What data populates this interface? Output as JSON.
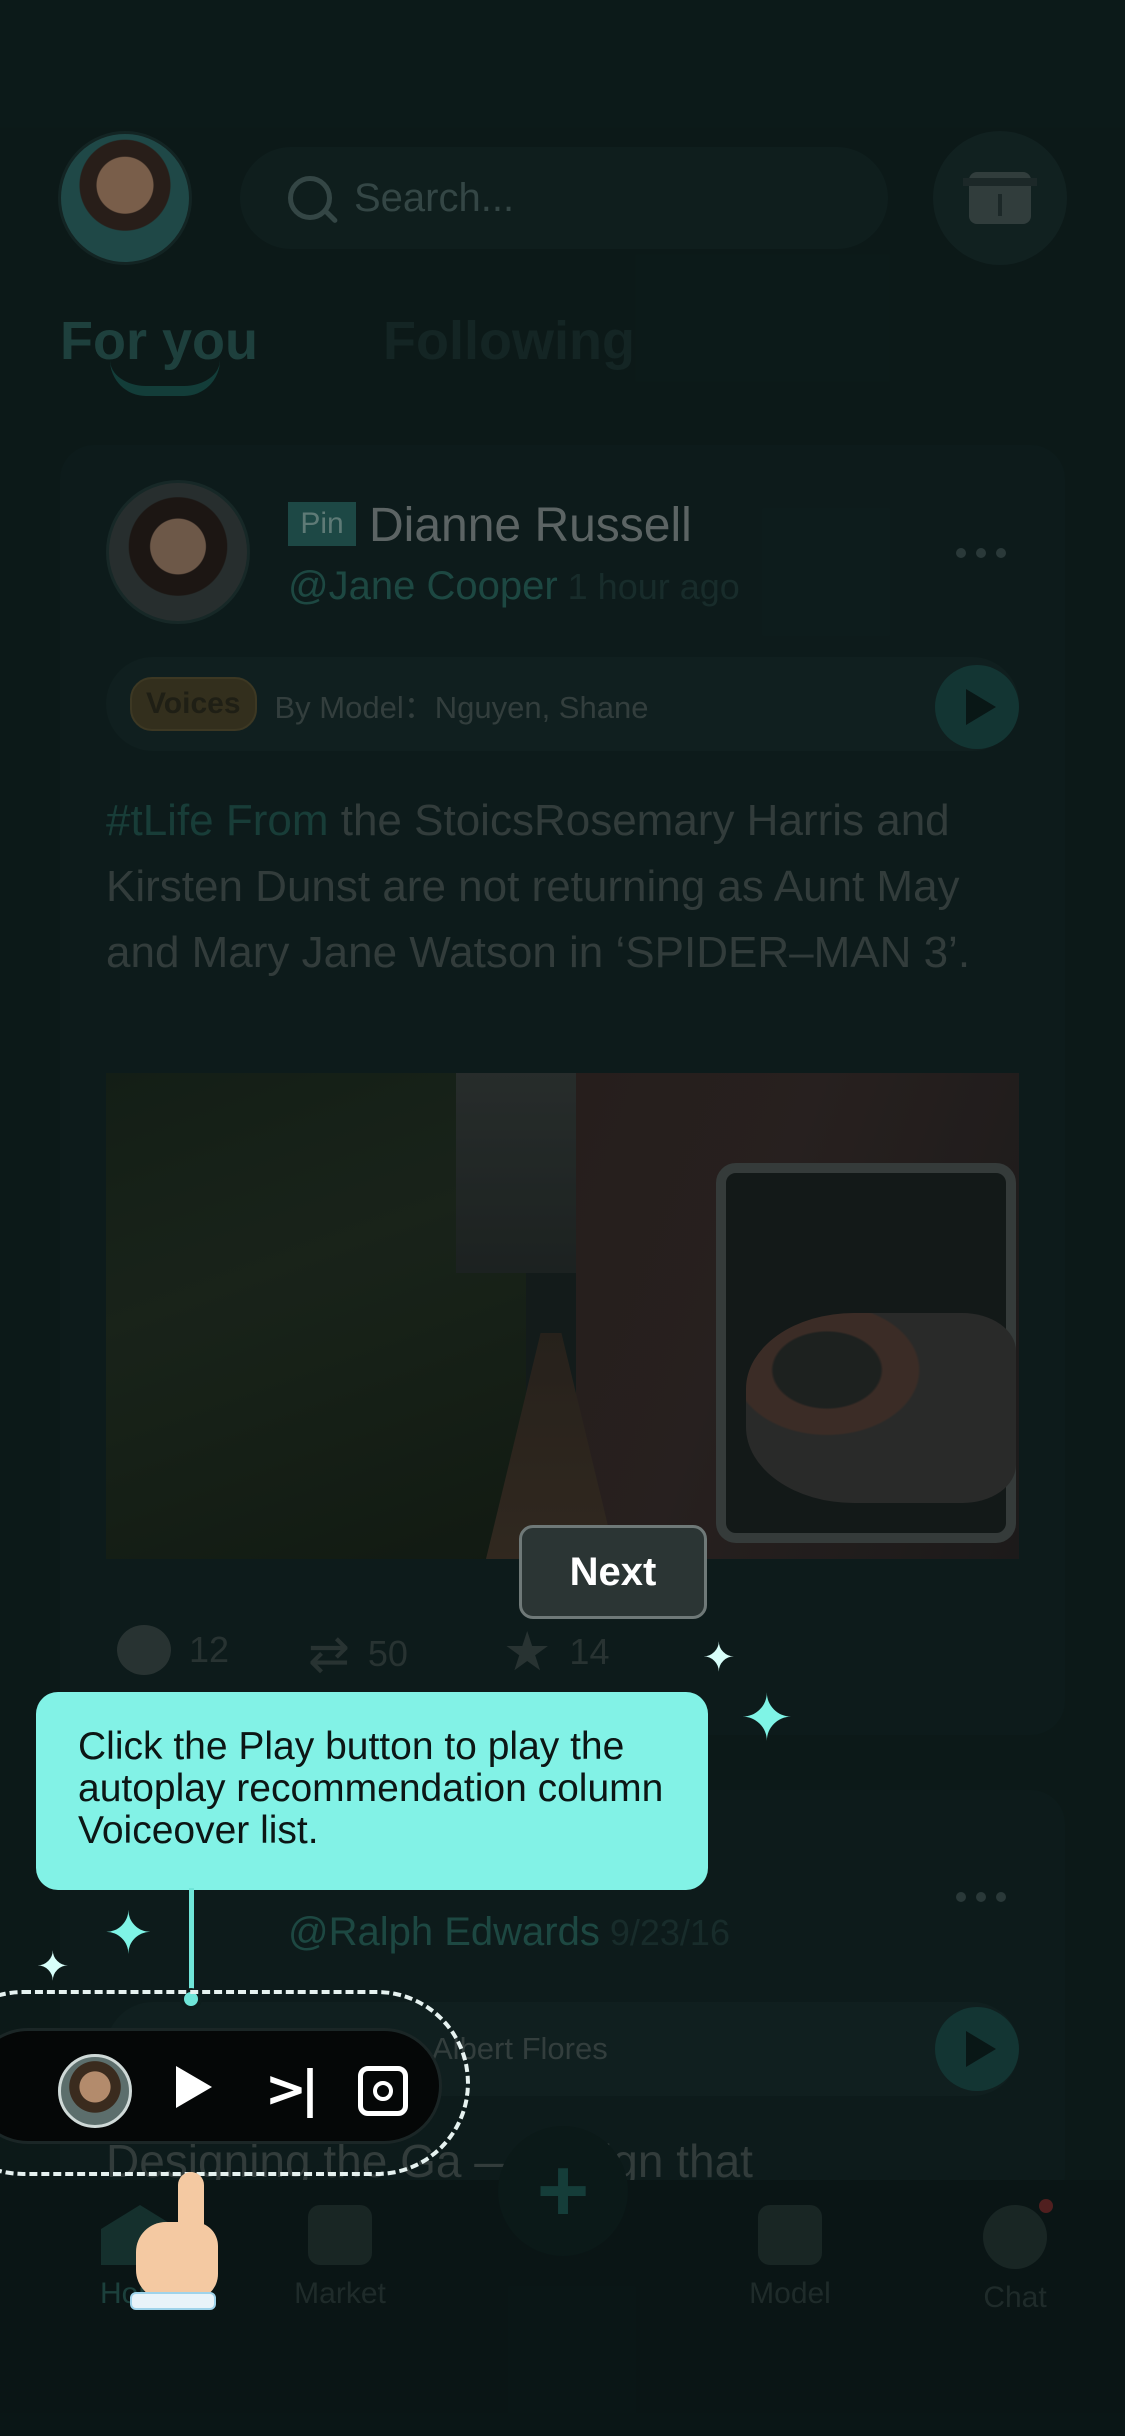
{
  "header": {
    "search_placeholder": "Search...",
    "tabs": [
      {
        "label": "For you",
        "active": true
      },
      {
        "label": "Following",
        "active": false
      }
    ]
  },
  "posts": [
    {
      "pin_label": "Pin",
      "author_name": "Dianne Russell",
      "handle": "@Jane Cooper",
      "time": "1 hour ago",
      "voice_tag": "Voices",
      "by_model": "By Model：Nguyen, Shane",
      "hashtag": " #tLife From",
      "text": " the StoicsRosemary Harris and Kirsten Dunst are not returning as Aunt May and Mary Jane Watson in ‘SPIDER–MAN 3’.",
      "comments": "12",
      "reposts": "50",
      "stars": "14"
    },
    {
      "handle": "@Ralph Edwards",
      "time": "9/23/16",
      "model_names": "Albert Flores",
      "text": "Designing the Ga — A Sign that"
    }
  ],
  "coach": {
    "next_label": "Next",
    "tooltip": "Click the Play button to play the autoplay recommendation column Voiceover list."
  },
  "bottom_nav": {
    "home": "Home",
    "market": "Market",
    "model": "Model",
    "chat": "Chat"
  },
  "colors": {
    "accent": "#82f2e6",
    "background": "#112221"
  }
}
